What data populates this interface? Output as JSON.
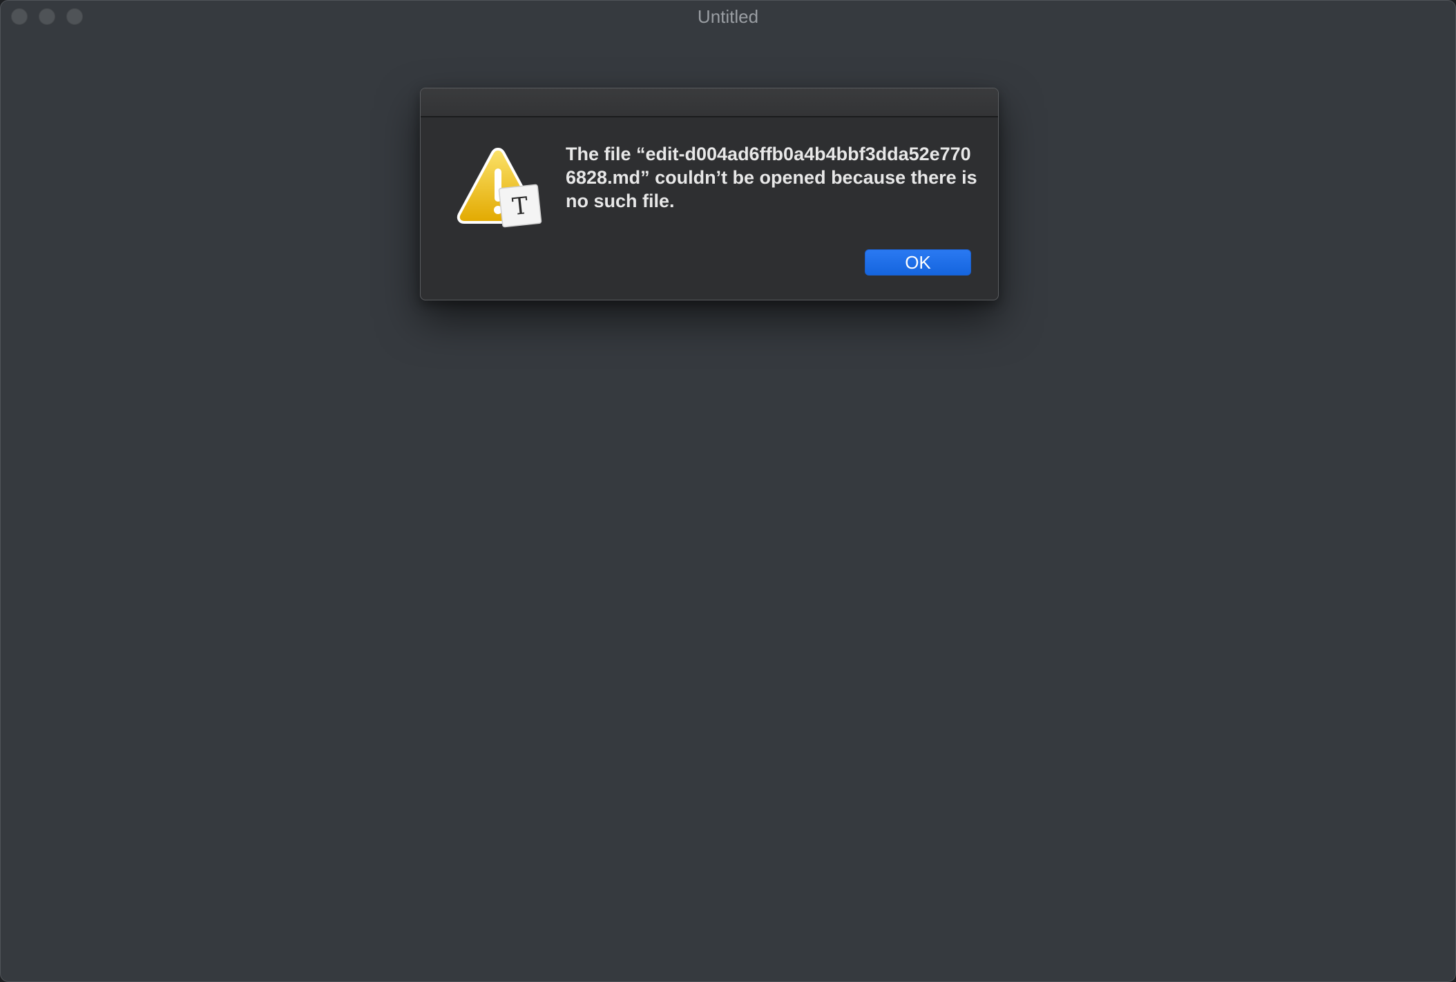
{
  "window": {
    "title": "Untitled"
  },
  "alert": {
    "message": "The file “edit-d004ad6ffb0a4b4bbf3dda52e7706828.md” couldn’t be opened because there is no such file.",
    "ok_label": "OK",
    "icon": "warning-triangle-with-document-icon",
    "badge_letter": "T"
  },
  "colors": {
    "window_background": "#363a3f",
    "sheet_background": "#2e2f31",
    "accent_button": "#1a6ce8",
    "warning_yellow": "#f2c40f"
  }
}
